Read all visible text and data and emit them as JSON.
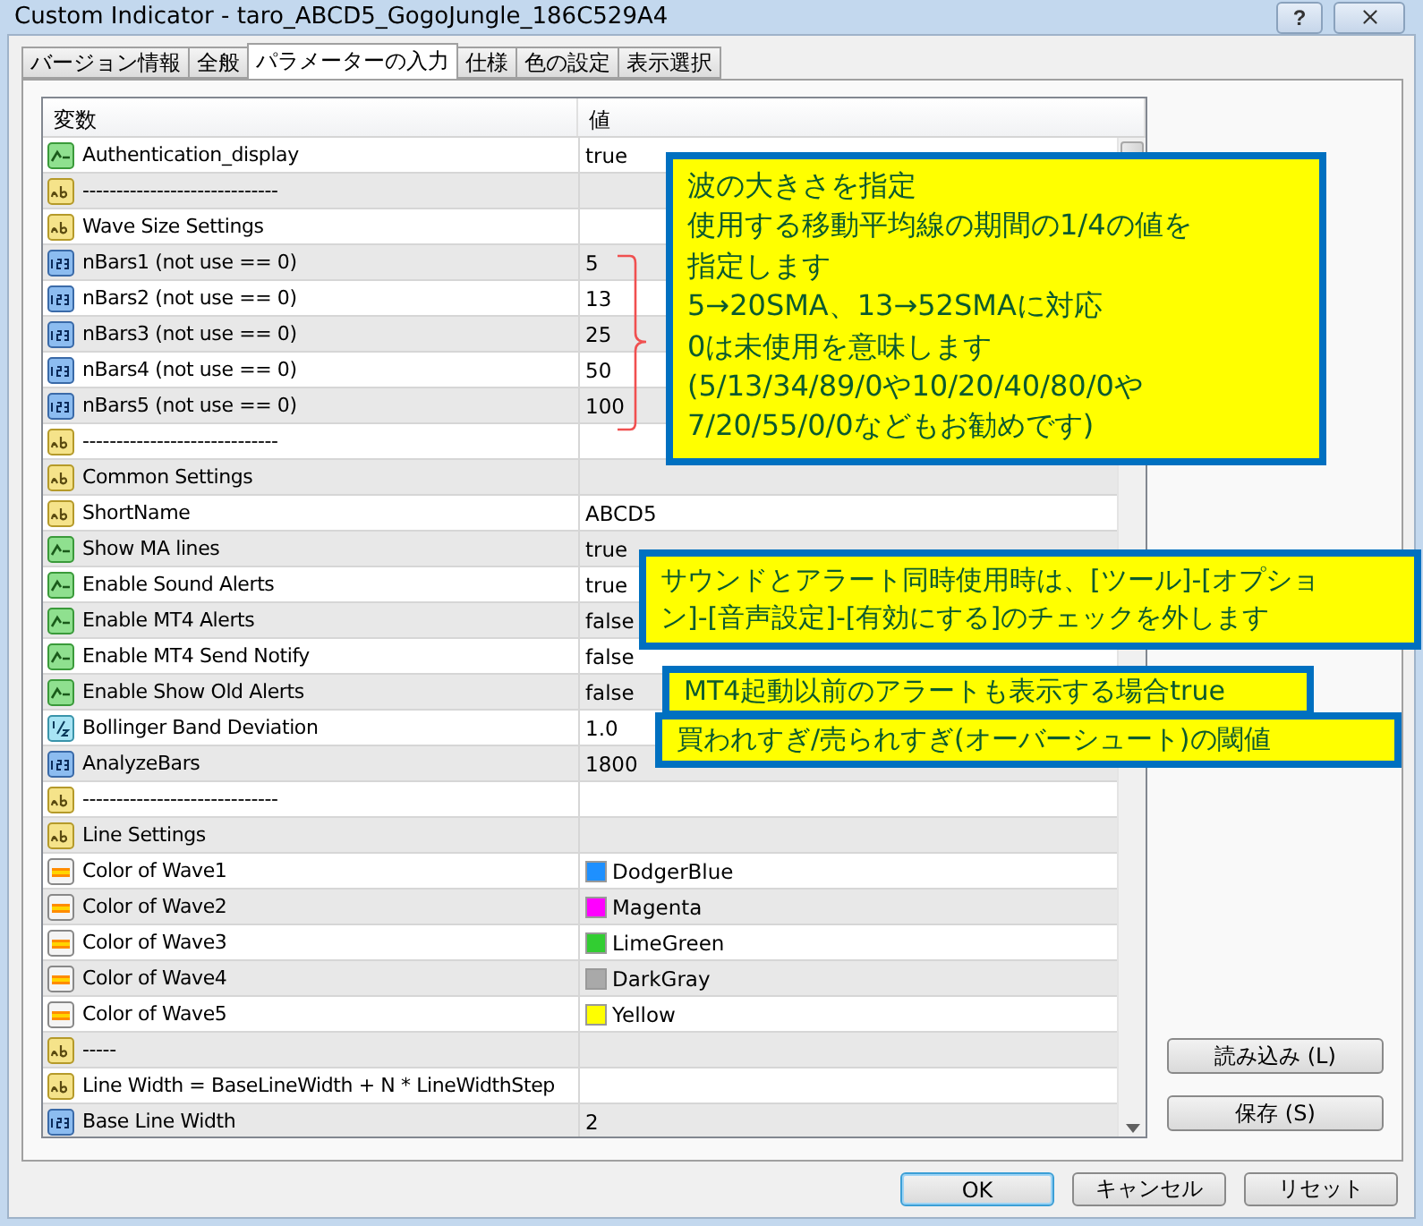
{
  "window": {
    "title": "Custom Indicator - taro_ABCD5_GogoJungle_186C529A4",
    "help_label": "?"
  },
  "tabs": [
    {
      "label": "バージョン情報",
      "selected": false
    },
    {
      "label": "全般",
      "selected": false
    },
    {
      "label": "パラメーターの入力",
      "selected": true
    },
    {
      "label": "仕様",
      "selected": false
    },
    {
      "label": "色の設定",
      "selected": false
    },
    {
      "label": "表示選択",
      "selected": false
    }
  ],
  "table": {
    "columns": [
      "変数",
      "値"
    ],
    "rows": [
      {
        "kind": "bool",
        "name": "Authentication_display",
        "value": "true"
      },
      {
        "kind": "string",
        "name": "-----------------------------"
      },
      {
        "kind": "string",
        "name": "Wave Size Settings"
      },
      {
        "kind": "int",
        "name": "nBars1 (not use == 0)",
        "value": "5"
      },
      {
        "kind": "int",
        "name": "nBars2 (not use == 0)",
        "value": "13"
      },
      {
        "kind": "int",
        "name": "nBars3 (not use == 0)",
        "value": "25"
      },
      {
        "kind": "int",
        "name": "nBars4 (not use == 0)",
        "value": "50"
      },
      {
        "kind": "int",
        "name": "nBars5 (not use == 0)",
        "value": "100"
      },
      {
        "kind": "string",
        "name": "-----------------------------"
      },
      {
        "kind": "string",
        "name": "Common Settings"
      },
      {
        "kind": "string",
        "name": "ShortName",
        "value": "ABCD5"
      },
      {
        "kind": "bool",
        "name": "Show MA lines",
        "value": "true"
      },
      {
        "kind": "bool",
        "name": "Enable Sound Alerts",
        "value": "true"
      },
      {
        "kind": "bool",
        "name": "Enable MT4 Alerts",
        "value": "false"
      },
      {
        "kind": "bool",
        "name": "Enable MT4 Send Notify",
        "value": "false"
      },
      {
        "kind": "bool",
        "name": "Enable Show Old Alerts",
        "value": "false"
      },
      {
        "kind": "double",
        "name": "Bollinger Band Deviation",
        "value": "1.0"
      },
      {
        "kind": "int",
        "name": "AnalyzeBars",
        "value": "1800"
      },
      {
        "kind": "string",
        "name": "-----------------------------"
      },
      {
        "kind": "string",
        "name": "Line Settings"
      },
      {
        "kind": "color",
        "name": "Color of Wave1",
        "value": "DodgerBlue",
        "color": "#1e90ff"
      },
      {
        "kind": "color",
        "name": "Color of Wave2",
        "value": "Magenta",
        "color": "#ff00ff"
      },
      {
        "kind": "color",
        "name": "Color of Wave3",
        "value": "LimeGreen",
        "color": "#32cd32"
      },
      {
        "kind": "color",
        "name": "Color of Wave4",
        "value": "DarkGray",
        "color": "#a9a9a9"
      },
      {
        "kind": "color",
        "name": "Color of Wave5",
        "value": "Yellow",
        "color": "#ffff00"
      },
      {
        "kind": "string",
        "name": "-----"
      },
      {
        "kind": "string",
        "name": "Line Width = BaseLineWidth + N * LineWidthStep"
      },
      {
        "kind": "int",
        "name": "Base Line Width",
        "value": "2"
      }
    ]
  },
  "side_buttons": [
    "読み込み (L)",
    "保存 (S)"
  ],
  "footer_buttons": [
    {
      "label": "OK",
      "selected": true
    },
    {
      "label": "キャンセル",
      "selected": false
    },
    {
      "label": "リセット",
      "selected": false
    }
  ],
  "callouts": [
    {
      "lines": [
        "波の大きさを指定",
        "使用する移動平均線の期間の1/4の値を",
        "指定します",
        "5→20SMA、13→52SMAに対応",
        "0は未使用を意味します",
        "(5/13/34/89/0や10/20/40/80/0や",
        "7/20/55/0/0などもお勧めです)"
      ]
    },
    {
      "lines": [
        "サウンドとアラート同時使用時は、[ツール]-[オプショ",
        "ン]-[音声設定]-[有効にする]のチェックを外します"
      ]
    },
    {
      "lines": [
        "MT4起動以前のアラートも表示する場合true"
      ]
    },
    {
      "lines": [
        "買われすぎ/売られすぎ(オーバーシュート)の閾値"
      ]
    }
  ]
}
